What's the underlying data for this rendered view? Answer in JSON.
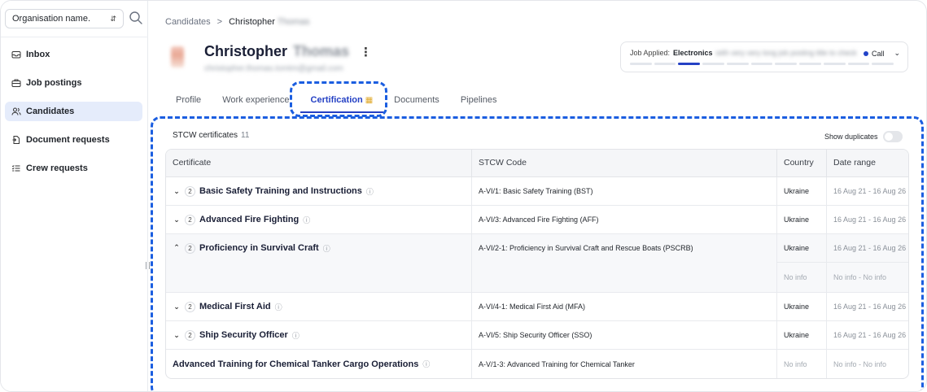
{
  "sidebar": {
    "org_select": "Organisation name.",
    "items": [
      {
        "label": "Inbox",
        "icon": "inbox-icon"
      },
      {
        "label": "Job postings",
        "icon": "briefcase-icon"
      },
      {
        "label": "Candidates",
        "icon": "users-icon",
        "active": true
      },
      {
        "label": "Document requests",
        "icon": "document-icon"
      },
      {
        "label": "Crew requests",
        "icon": "list-icon"
      }
    ]
  },
  "breadcrumb": {
    "parent": "Candidates",
    "separator": ">",
    "current": "Christopher",
    "current_blurred": "Thomas"
  },
  "candidate": {
    "first_name": "Christopher",
    "last_name_blurred": "Thomas",
    "email_blurred": "christopher.thomas.tomtm@gmail.com"
  },
  "job": {
    "label": "Job Applied:",
    "value": "Electronics",
    "blurred_rest": "with very very long job posting title to check",
    "status": "Call",
    "progress_steps": 11,
    "progress_active": [
      2
    ]
  },
  "tabs": [
    {
      "label": "Profile"
    },
    {
      "label": "Work experience"
    },
    {
      "label": "Certification",
      "active": true
    },
    {
      "label": "Documents"
    },
    {
      "label": "Pipelines"
    }
  ],
  "section": {
    "title": "STCW certificates",
    "count": "11",
    "dup_label": "Show duplicates"
  },
  "table": {
    "headers": [
      "Certificate",
      "STCW Code",
      "Country",
      "Date range"
    ],
    "rows": [
      {
        "name": "Basic Safety Training and Instructions",
        "count": "2",
        "code": "A-VI/1: Basic Safety Training (BST)",
        "country": "Ukraine",
        "range": "16 Aug 21 - 16 Aug 26"
      },
      {
        "name": "Advanced Fire Fighting",
        "count": "2",
        "code": "A-VI/3: Advanced Fire Fighting (AFF)",
        "country": "Ukraine",
        "range": "16 Aug 21 - 16 Aug 26"
      },
      {
        "name": "Proficiency in Survival Craft",
        "count": "2",
        "code": "A-VI/2-1: Proficiency in Survival Craft and Rescue Boats (PSCRB)",
        "country": "Ukraine",
        "range": "16 Aug 21 - 16 Aug 26",
        "country2": "No info",
        "range2": "No info - No info"
      },
      {
        "name": "Medical First Aid",
        "count": "2",
        "code": "A-VI/4-1: Medical First Aid (MFA)",
        "country": "Ukraine",
        "range": "16 Aug 21 - 16 Aug 26"
      },
      {
        "name": "Ship Security Officer",
        "count": "2",
        "code": "A-VI/5: Ship Security Officer (SSO)",
        "country": "Ukraine",
        "range": "16 Aug 21 - 16 Aug 26"
      },
      {
        "name": "Advanced Training for Chemical Tanker Cargo Operations",
        "code": "A-V/1-3: Advanced Training for Chemical Tanker",
        "country": "No info",
        "range": "No info - No info"
      }
    ]
  },
  "colors": {
    "accent": "#2541c4",
    "highlight_dash": "#1b5ee0",
    "active_nav_bg": "#e5ecfb"
  }
}
